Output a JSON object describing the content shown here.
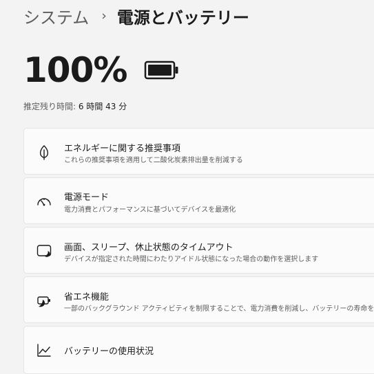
{
  "breadcrumb": {
    "parent": "システム",
    "separator": "›",
    "current": "電源とバッテリー"
  },
  "battery": {
    "percent_text": "100%",
    "level": 1.0,
    "icon": "battery-full-icon",
    "remaining_label": "推定残り時間:",
    "remaining_value": "6 時間 43 分"
  },
  "settings": [
    {
      "title": "エネルギーに関する推奨事項",
      "description": "これらの推奨事項を適用して二酸化炭素排出量を削減する",
      "icon": "leaf-icon"
    },
    {
      "title": "電源モード",
      "description": "電力消費とパフォーマンスに基づいてデバイスを最適化",
      "icon": "gauge-icon"
    },
    {
      "title": "画面、スリープ、休止状態のタイムアウト",
      "description": "デバイスが指定された時間にわたりアイドル状態になった場合の動作を選択します",
      "icon": "screen-timeout-icon"
    },
    {
      "title": "省エネ機能",
      "description": "一部のバックグラウンド アクティビティを制限することで、電力消費を削減し、バッテリーの寿命を延ば",
      "icon": "battery-saver-icon"
    },
    {
      "title": "バッテリーの使用状況",
      "description": "",
      "icon": "chart-line-icon"
    }
  ]
}
